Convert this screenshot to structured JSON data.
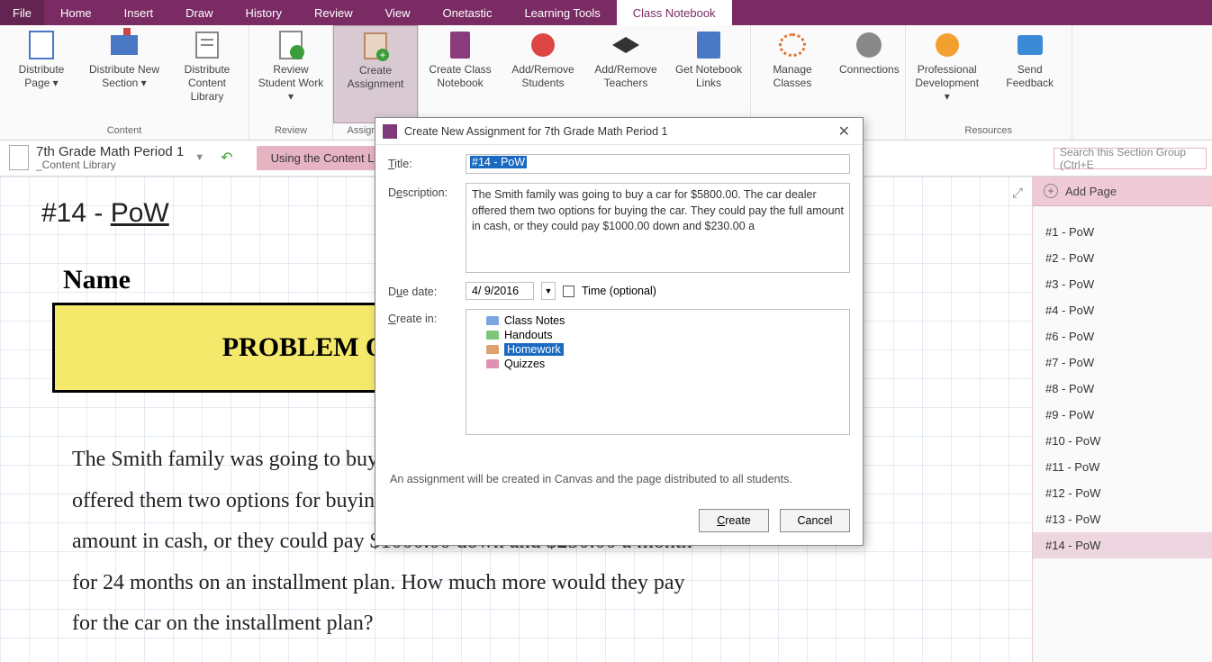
{
  "menubar": {
    "file": "File",
    "items": [
      "Home",
      "Insert",
      "Draw",
      "History",
      "Review",
      "View",
      "Onetastic",
      "Learning Tools",
      "Class Notebook"
    ],
    "active": "Class Notebook"
  },
  "ribbon": {
    "groups": [
      {
        "label": "Content",
        "buttons": [
          {
            "id": "distribute-page",
            "icon": "ic-page",
            "text": "Distribute Page ▾"
          },
          {
            "id": "distribute-new-section",
            "icon": "ic-sec",
            "text": "Distribute New Section ▾"
          },
          {
            "id": "distribute-content-library",
            "icon": "ic-lib",
            "text": "Distribute Content Library"
          }
        ]
      },
      {
        "label": "Review",
        "buttons": [
          {
            "id": "review-student-work",
            "icon": "ic-rev",
            "text": "Review Student Work ▾"
          }
        ]
      },
      {
        "label": "Assignments",
        "buttons": [
          {
            "id": "create-assignment",
            "icon": "ic-assign",
            "text": "Create Assignment",
            "highlight": true
          }
        ]
      },
      {
        "label": "",
        "buttons": [
          {
            "id": "create-class-notebook",
            "icon": "ic-nb",
            "text": "Create Class Notebook"
          },
          {
            "id": "add-remove-students",
            "icon": "ic-person",
            "text": "Add/Remove Students"
          },
          {
            "id": "add-remove-teachers",
            "icon": "ic-grad",
            "text": "Add/Remove Teachers"
          },
          {
            "id": "get-notebook-links",
            "icon": "ic-link",
            "text": "Get Notebook Links"
          }
        ]
      },
      {
        "label": "",
        "buttons": [
          {
            "id": "manage-classes",
            "icon": "ic-mgr",
            "text": "Manage Classes"
          },
          {
            "id": "connections",
            "icon": "ic-gear",
            "text": "Connections"
          }
        ]
      },
      {
        "label": "Resources",
        "buttons": [
          {
            "id": "professional-development",
            "icon": "ic-prof",
            "text": "Professional Development ▾"
          },
          {
            "id": "send-feedback",
            "icon": "ic-fb",
            "text": "Send Feedback"
          }
        ]
      }
    ]
  },
  "nav": {
    "notebook": "7th Grade Math Period 1",
    "section": "_Content Library",
    "tab": "Using the Content Library",
    "search_placeholder": "Search this Section Group (Ctrl+E"
  },
  "page": {
    "title_pre": "#14 - ",
    "title_u": "PoW",
    "name": "Name",
    "box": "PROBLEM O",
    "body": "The Smith family was going to buy a car for $5800.00. The car dealer offered them two options for buying the car. They could pay the full amount in cash, or they could pay $1000.00 down and $230.00 a month for 24 months on an installment plan. How much more would they pay for the car on the installment plan?"
  },
  "pagelist": {
    "add": "Add Page",
    "pages": [
      "#1 - PoW",
      "#2 - PoW",
      "#3 - PoW",
      "#4 - PoW",
      "#6 - PoW",
      "#7 - PoW",
      "#8 - PoW",
      "#9 - PoW",
      "#10 - PoW",
      "#11 - PoW",
      "#12 - PoW",
      "#13 - PoW",
      "#14 - PoW"
    ],
    "current": "#14 - PoW"
  },
  "dialog": {
    "title": "Create New Assignment for 7th Grade Math Period 1",
    "labels": {
      "title": "Title:",
      "description": "Description:",
      "due": "Due date:",
      "create_in": "Create in:",
      "time": "Time (optional)"
    },
    "fields": {
      "title": "#14 - PoW",
      "description": "The Smith family was going to buy a car for $5800.00. The car dealer offered them two options for buying the car. They could pay the full amount in cash, or they could pay $1000.00 down and $230.00 a",
      "due_date": "4/  9/2016"
    },
    "tree": [
      {
        "name": "Class Notes",
        "color": "#7aa7e0"
      },
      {
        "name": "Handouts",
        "color": "#7ac77a"
      },
      {
        "name": "Homework",
        "color": "#e0a070",
        "selected": true
      },
      {
        "name": "Quizzes",
        "color": "#e090b0"
      }
    ],
    "note": "An assignment will be created in Canvas and the page distributed to all students.",
    "buttons": {
      "create": "Create",
      "cancel": "Cancel"
    }
  }
}
